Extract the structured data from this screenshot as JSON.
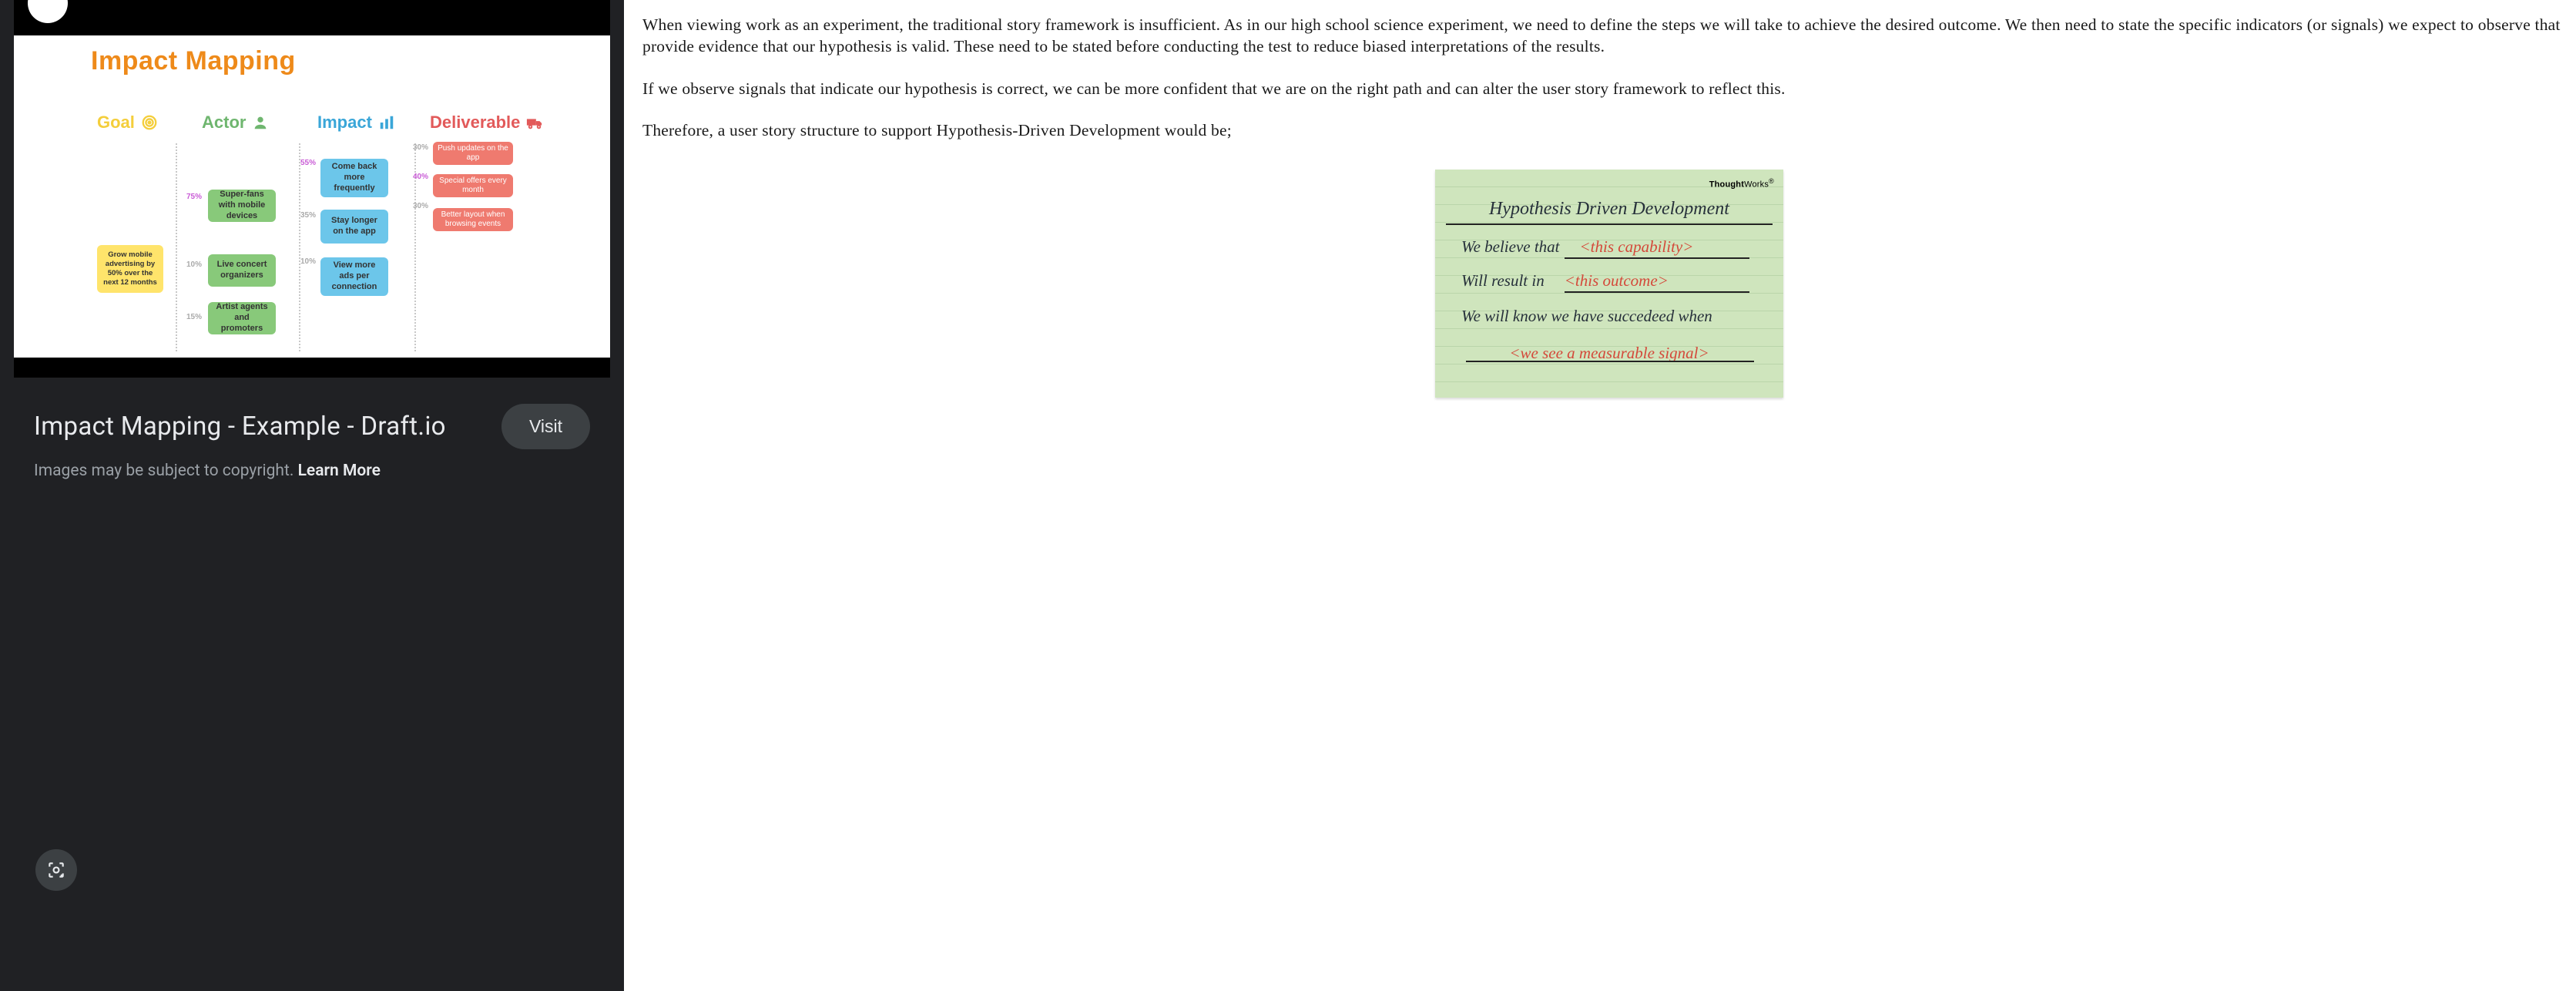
{
  "left": {
    "result_title": "Impact Mapping - Example - Draft.io",
    "visit_label": "Visit",
    "copyright_text": "Images may be subject to copyright. ",
    "learn_more": "Learn More"
  },
  "diagram": {
    "title": "Impact Mapping",
    "headers": {
      "goal": "Goal",
      "actor": "Actor",
      "impact": "Impact",
      "deliverable": "Deliverable"
    },
    "goal_node": "Grow mobile advertising by 50% over the next 12 months",
    "actors": {
      "a1": "Super-fans with mobile devices",
      "a2": "Live concert organizers",
      "a3": "Artist agents and promoters"
    },
    "impacts": {
      "i1": "Come back more frequently",
      "i2": "Stay longer on the app",
      "i3": "View more ads per connection"
    },
    "deliverables": {
      "d1": "Push updates on the app",
      "d2": "Special offers every month",
      "d3": "Better layout when browsing events"
    },
    "percentages": {
      "goal_a1": "75%",
      "goal_a2": "10%",
      "goal_a3": "15%",
      "a1_i1": "55%",
      "a1_i2": "35%",
      "a1_i3": "10%",
      "i1_d1": "30%",
      "i1_d2": "40%",
      "i1_d3": "30%"
    }
  },
  "article": {
    "p1": "When viewing work as an experiment, the traditional story framework is insufficient. As in our high school science experiment, we need to define the steps we will take to achieve the desired outcome. We then need to state the specific indicators (or signals) we expect to observe that provide evidence that our hypothesis is valid. These need to be stated before conducting the test to reduce biased interpretations of the results.",
    "p2": "If we observe signals that indicate our hypothesis is correct, we can be more confident that we are on the right path and can alter the user story framework to reflect this.",
    "p3": "Therefore, a user story structure to support Hypothesis-Driven Development would be;"
  },
  "card": {
    "brand_bold": "Thought",
    "brand_rest": "Works",
    "title": "Hypothesis Driven Development",
    "line1_label": "We believe that",
    "line1_fill": "<this capability>",
    "line2_label": "Will result in",
    "line2_fill": "<this outcome>",
    "line3_label": "We will know we have succedeed when",
    "signal": "<we see a measurable signal>"
  }
}
